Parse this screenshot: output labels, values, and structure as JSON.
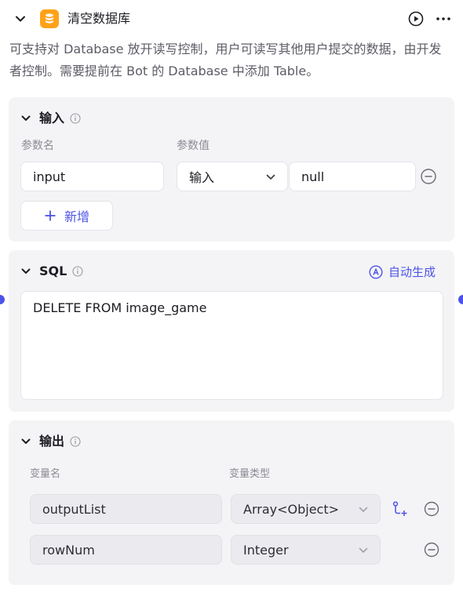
{
  "header": {
    "title": "清空数据库",
    "description": "可支持对 Database 放开读写控制，用户可读写其他用户提交的数据，由开发者控制。需要提前在 Bot 的 Database 中添加 Table。"
  },
  "input_section": {
    "title": "输入",
    "param_name_label": "参数名",
    "param_value_label": "参数值",
    "params": [
      {
        "name": "input",
        "type": "输入",
        "value": "null"
      }
    ],
    "add_label": "新增"
  },
  "sql_section": {
    "title": "SQL",
    "auto_generate_label": "自动生成",
    "query": "DELETE FROM image_game"
  },
  "output_section": {
    "title": "输出",
    "var_name_label": "变量名",
    "var_type_label": "变量类型",
    "vars": [
      {
        "name": "outputList",
        "type": "Array<Object>"
      },
      {
        "name": "rowNum",
        "type": "Integer"
      }
    ]
  },
  "colors": {
    "accent": "#4d53e8",
    "db_icon": "#ffa21a",
    "card_bg": "#f4f4f6"
  },
  "icons": {
    "collapse": "chevron-down-icon",
    "node": "database-icon",
    "run": "play-circle-icon",
    "more": "more-horizontal-icon",
    "info": "info-icon",
    "remove": "minus-circle-icon",
    "add": "plus-icon",
    "auto": "auto-letter-a-icon",
    "sub_field": "branch-add-icon"
  }
}
